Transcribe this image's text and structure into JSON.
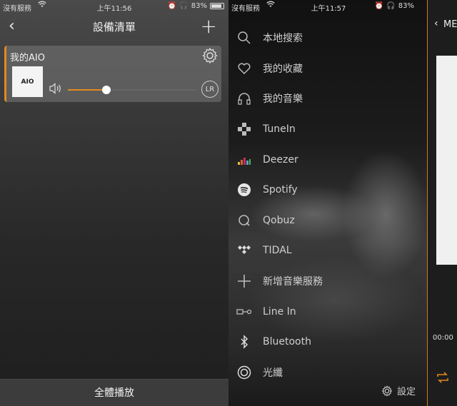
{
  "left_screen": {
    "status": {
      "carrier": "沒有服務",
      "time": "上午11:56",
      "battery": "83%"
    },
    "nav": {
      "back": "‹",
      "title": "設備清單",
      "add": "+"
    },
    "device": {
      "name": "我的AIO",
      "album_text": "AIO",
      "volume_level": 0.3,
      "channel_badge": "LR",
      "accent_color": "#e08a1e"
    },
    "bottom_button": "全體播放"
  },
  "right_screen": {
    "status": {
      "carrier": "沒有服務",
      "time": "上午11:57",
      "battery": "83%"
    },
    "menu": [
      {
        "icon": "search-icon",
        "label": "本地搜索"
      },
      {
        "icon": "heart-icon",
        "label": "我的收藏"
      },
      {
        "icon": "headphones-icon",
        "label": "我的音樂"
      },
      {
        "icon": "tunein-icon",
        "label": "TuneIn"
      },
      {
        "icon": "deezer-icon",
        "label": "Deezer"
      },
      {
        "icon": "spotify-icon",
        "label": "Spotify"
      },
      {
        "icon": "qobuz-icon",
        "label": "Qobuz"
      },
      {
        "icon": "tidal-icon",
        "label": "TIDAL"
      },
      {
        "icon": "plus-icon",
        "label": "新增音樂服務"
      },
      {
        "icon": "line-in-icon",
        "label": "Line In"
      },
      {
        "icon": "bluetooth-icon",
        "label": "Bluetooth"
      },
      {
        "icon": "optical-icon",
        "label": "光纖"
      }
    ],
    "settings_label": "設定",
    "side_panel": {
      "back": "‹",
      "title": "ME",
      "time": "00:00"
    }
  }
}
